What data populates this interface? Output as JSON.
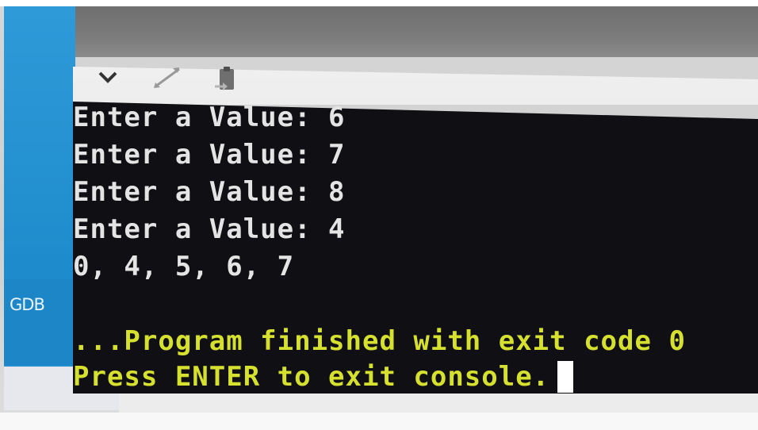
{
  "sidebar": {
    "label": "GDB"
  },
  "toolbar": {
    "buttons": [
      {
        "icon": "chevron-down-icon"
      },
      {
        "icon": "expand-icon"
      },
      {
        "icon": "copy-to-clipboard-icon"
      }
    ]
  },
  "console": {
    "lines": [
      "Enter a Value: 6",
      "Enter a Value: 7",
      "Enter a Value: 8",
      "Enter a Value: 4",
      "0, 4, 5, 6, 7"
    ],
    "finish_message": "...Program finished with exit code 0",
    "prompt": "Press ENTER to exit console."
  },
  "colors": {
    "terminal_bg": "#0f0f14",
    "output_text": "#e4e4e4",
    "status_text": "#d6e02f",
    "sidebar": "#1e8ccc"
  }
}
